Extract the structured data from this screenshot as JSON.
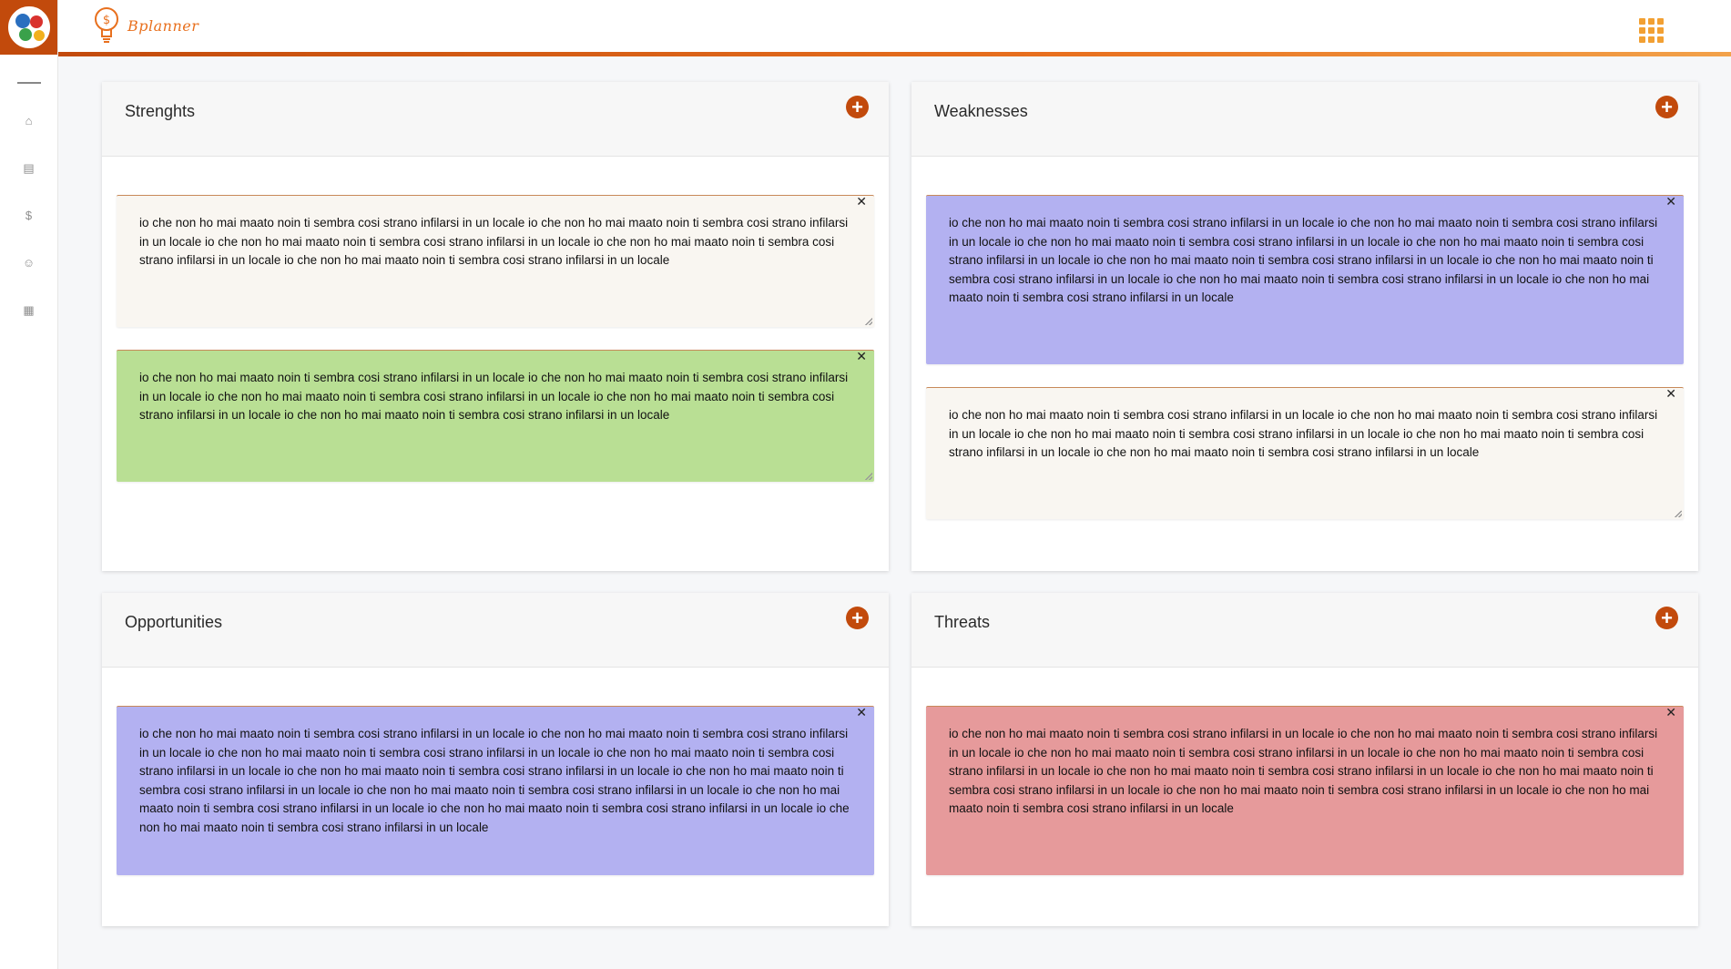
{
  "app": {
    "name": "Bplanner"
  },
  "colors": {
    "brand": "#c24a0c",
    "accent": "#e8701e",
    "note_cream": "#f9f6f1",
    "note_green": "#b9df94",
    "note_purple": "#b3b1f1",
    "note_red": "#e69a9b"
  },
  "sidebar": {
    "items": [
      {
        "icon": "home-icon",
        "glyph": "⌂"
      },
      {
        "icon": "document-icon",
        "glyph": "▤"
      },
      {
        "icon": "dollar-icon",
        "glyph": "$"
      },
      {
        "icon": "smiley-icon",
        "glyph": "☺"
      },
      {
        "icon": "dashboard-icon",
        "glyph": "▦"
      }
    ]
  },
  "quadrants": {
    "strengths": {
      "title": "Strenghts",
      "add_label": "+",
      "notes": [
        {
          "color": "cream",
          "text": "io che non ho mai maato noin ti sembra cosi strano infilarsi in un locale io che non ho mai maato noin ti sembra cosi strano infilarsi in un locale io che non ho mai maato noin ti sembra cosi strano infilarsi in un locale io che non ho mai maato noin ti sembra cosi strano infilarsi in un locale io che non ho mai maato noin ti sembra cosi strano infilarsi in un locale"
        },
        {
          "color": "green",
          "text": "io che non ho mai maato noin ti sembra cosi strano infilarsi in un locale io che non ho mai maato noin ti sembra cosi strano infilarsi in un locale io che non ho mai maato noin ti sembra cosi strano infilarsi in un locale io che non ho mai maato noin ti sembra cosi strano infilarsi in un locale io che non ho mai maato noin ti sembra cosi strano infilarsi in un locale"
        }
      ]
    },
    "weaknesses": {
      "title": "Weaknesses",
      "add_label": "+",
      "notes": [
        {
          "color": "purple",
          "text": "io che non ho mai maato noin ti sembra cosi strano infilarsi in un locale io che non ho mai maato noin ti sembra cosi strano infilarsi in un locale io che non ho mai maato noin ti sembra cosi strano infilarsi in un locale io che non ho mai maato noin ti sembra cosi strano infilarsi in un locale io che non ho mai maato noin ti sembra cosi strano infilarsi in un locale io che non ho mai maato noin ti sembra cosi strano infilarsi in un locale io che non ho mai maato noin ti sembra cosi strano infilarsi in un locale io che non ho mai maato noin ti sembra cosi strano infilarsi in un locale"
        },
        {
          "color": "cream",
          "text": "io che non ho mai maato noin ti sembra cosi strano infilarsi in un locale io che non ho mai maato noin ti sembra cosi strano infilarsi in un locale io che non ho mai maato noin ti sembra cosi strano infilarsi in un locale io che non ho mai maato noin ti sembra cosi strano infilarsi in un locale io che non ho mai maato noin ti sembra cosi strano infilarsi in un locale"
        }
      ]
    },
    "opportunities": {
      "title": "Opportunities",
      "add_label": "+",
      "notes": [
        {
          "color": "purple",
          "text": "io che non ho mai maato noin ti sembra cosi strano infilarsi in un locale io che non ho mai maato noin ti sembra cosi strano infilarsi in un locale io che non ho mai maato noin ti sembra cosi strano infilarsi in un locale io che non ho mai maato noin ti sembra cosi strano infilarsi in un locale io che non ho mai maato noin ti sembra cosi strano infilarsi in un locale io che non ho mai maato noin ti sembra cosi strano infilarsi in un locale io che non ho mai maato noin ti sembra cosi strano infilarsi in un locale io che non ho mai maato noin ti sembra cosi strano infilarsi in un locale io che non ho mai maato noin ti sembra cosi strano infilarsi in un locale io che non ho mai maato noin ti sembra cosi strano infilarsi in un locale"
        }
      ]
    },
    "threats": {
      "title": "Threats",
      "add_label": "+",
      "notes": [
        {
          "color": "red",
          "text": "io che non ho mai maato noin ti sembra cosi strano infilarsi in un locale io che non ho mai maato noin ti sembra cosi strano infilarsi in un locale io che non ho mai maato noin ti sembra cosi strano infilarsi in un locale io che non ho mai maato noin ti sembra cosi strano infilarsi in un locale io che non ho mai maato noin ti sembra cosi strano infilarsi in un locale io che non ho mai maato noin ti sembra cosi strano infilarsi in un locale io che non ho mai maato noin ti sembra cosi strano infilarsi in un locale io che non ho mai maato noin ti sembra cosi strano infilarsi in un locale"
        }
      ]
    }
  },
  "note_close_label": "✕"
}
